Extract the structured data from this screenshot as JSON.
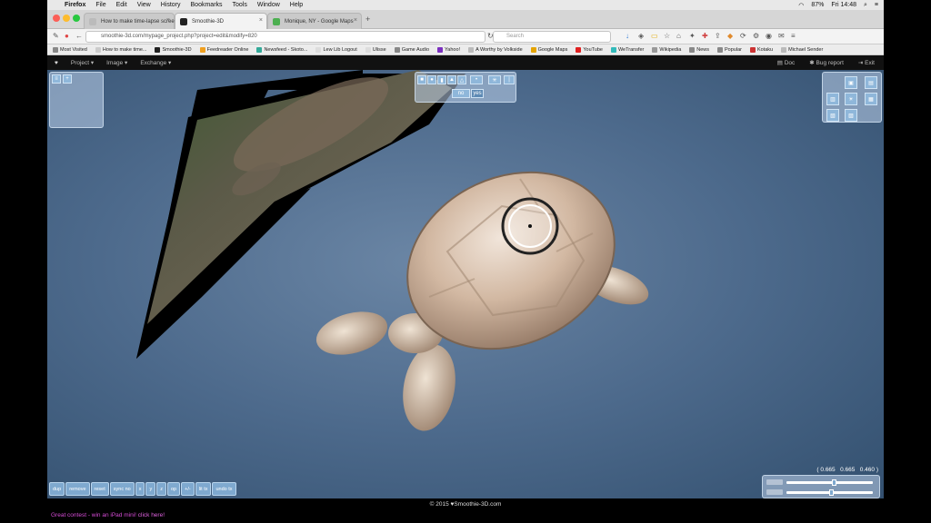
{
  "menubar": {
    "apple": "",
    "items": [
      "Firefox",
      "File",
      "Edit",
      "View",
      "History",
      "Bookmarks",
      "Tools",
      "Window",
      "Help"
    ],
    "battery": "87%",
    "clock": "Fri 14:48"
  },
  "tabs": [
    {
      "label": "How to make time-lapse screen..."
    },
    {
      "label": "Smoothie-3D"
    },
    {
      "label": "Monique, NY - Google Maps"
    }
  ],
  "navbar": {
    "url": "smoothie-3d.com/mypage_project.php?project=edit&modify=820",
    "search_placeholder": "Search"
  },
  "bookmarks": [
    "Most Visited",
    "How to make time...",
    "Smoothie-3D",
    "Feedreader Online",
    "Newsfeed - Skoto...",
    "Lew Lib Logout",
    "Ulisse",
    "Game Audio",
    "Yahoo!",
    "A Worthy by Volkside",
    "Google Maps",
    "YouTube",
    "WeTransfer",
    "Wikipedia",
    "News",
    "Popular",
    "Kotaku",
    "Michael Sender"
  ],
  "app_toolbar": {
    "menus": [
      "Project ▾",
      "Image ▾",
      "Exchange ▾"
    ],
    "right": [
      "Doc",
      "Bug report",
      "Exit"
    ]
  },
  "tool_panel": {
    "toggle_label": "no",
    "toggle_value": "yes"
  },
  "bottom_buttons": [
    "dup",
    "remove",
    "reset",
    "sync no",
    "x",
    "y",
    "z",
    "op",
    "+/-",
    "lit tx",
    "undo tx"
  ],
  "coords": "( 0.665   0.665   0.460 )",
  "sliders": [
    {
      "value": 0.55
    },
    {
      "value": 0.52
    }
  ],
  "footer": {
    "copyright": "© 2015 ♥Smoothie-3D.com",
    "promo": "Great contest - win an iPad mini!",
    "promo_link": "click here!"
  },
  "colors": {
    "viewport": "#4d6a8c",
    "accent": "#7fa9cf",
    "promo": "#d64cd6"
  }
}
